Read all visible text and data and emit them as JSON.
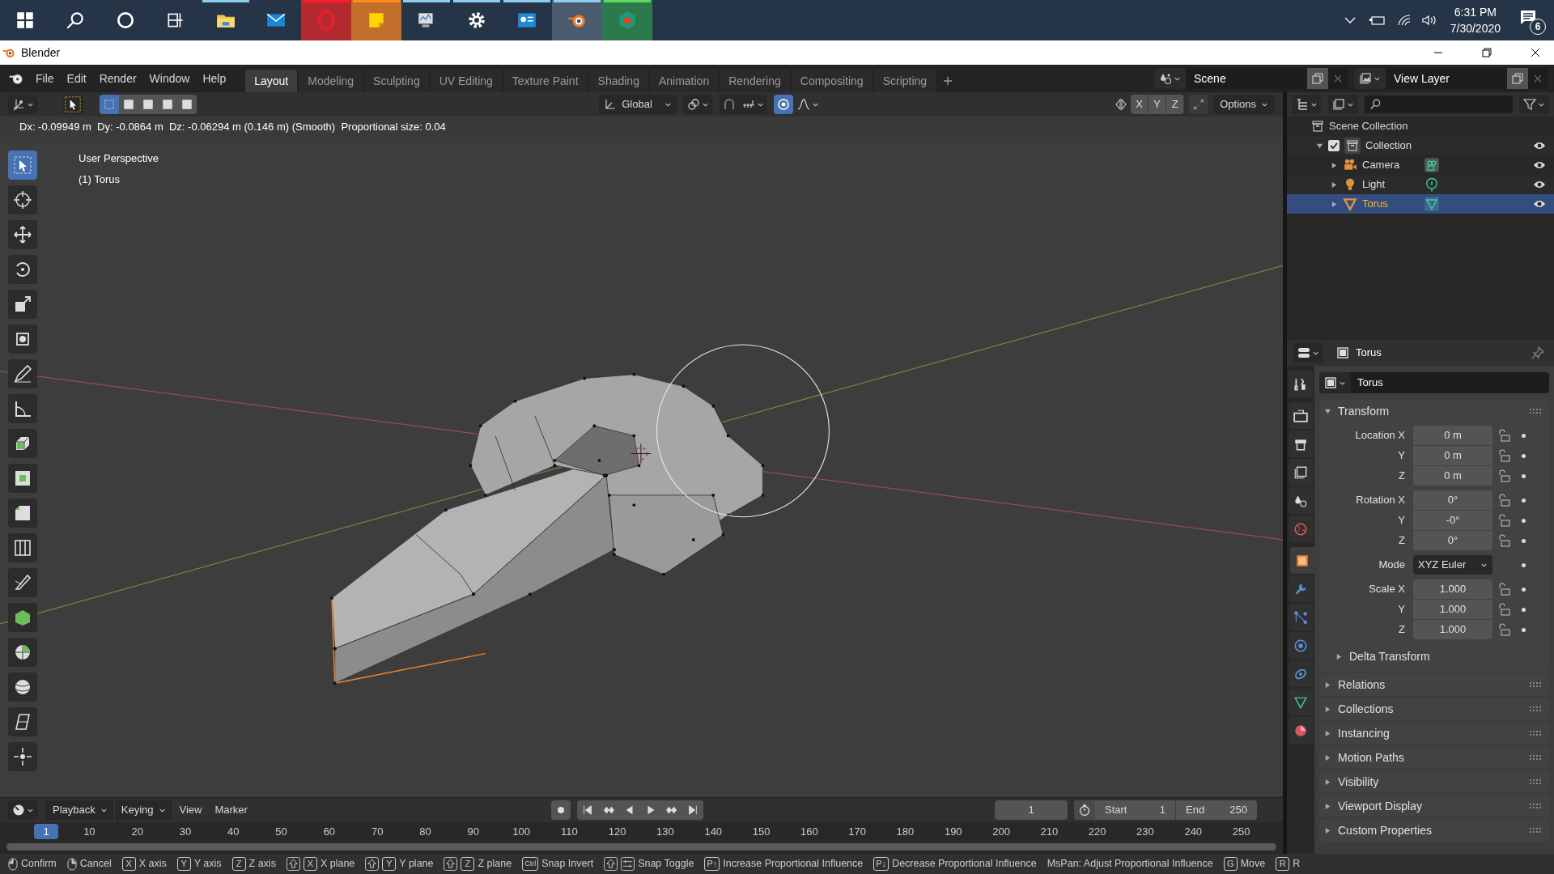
{
  "taskbar": {
    "apps": [
      {
        "kind": "start",
        "running": false,
        "selected": false
      },
      {
        "kind": "search",
        "running": false,
        "selected": false
      },
      {
        "kind": "cortana",
        "running": false,
        "selected": false
      },
      {
        "kind": "taskview",
        "running": false,
        "selected": false
      },
      {
        "kind": "explorer",
        "running": true,
        "selected": false
      },
      {
        "kind": "mail",
        "running": false,
        "selected": false
      },
      {
        "kind": "opera",
        "running": true,
        "selected": false
      },
      {
        "kind": "sticky",
        "running": true,
        "selected": false
      },
      {
        "kind": "monitor",
        "running": true,
        "selected": false
      },
      {
        "kind": "settings",
        "running": true,
        "selected": false
      },
      {
        "kind": "contact",
        "running": true,
        "selected": false
      },
      {
        "kind": "blender",
        "running": true,
        "selected": true
      },
      {
        "kind": "store",
        "running": true,
        "selected": false
      }
    ],
    "tray": {
      "time": "6:31 PM",
      "date": "7/30/2020",
      "notifications": "6"
    }
  },
  "window": {
    "title": "Blender"
  },
  "menu": [
    "File",
    "Edit",
    "Render",
    "Window",
    "Help"
  ],
  "workspaces": [
    {
      "label": "Layout",
      "selected": true
    },
    {
      "label": "Modeling",
      "selected": false
    },
    {
      "label": "Sculpting",
      "selected": false
    },
    {
      "label": "UV Editing",
      "selected": false
    },
    {
      "label": "Texture Paint",
      "selected": false
    },
    {
      "label": "Shading",
      "selected": false
    },
    {
      "label": "Animation",
      "selected": false
    },
    {
      "label": "Rendering",
      "selected": false
    },
    {
      "label": "Compositing",
      "selected": false
    },
    {
      "label": "Scripting",
      "selected": false
    }
  ],
  "scene": "Scene",
  "view_layer": "View Layer",
  "viewport": {
    "orientation": "Global",
    "axes": [
      "X",
      "Y",
      "Z"
    ],
    "options": "Options",
    "header_text": "Dx: -0.09949 m  Dy: -0.0864 m  Dz: -0.06294 m (0.146 m) (Smooth)  Proportional size: 0.04",
    "overlay": [
      "User Perspective",
      "(1) Torus"
    ],
    "tools": [
      {
        "kind": "select",
        "selected": true
      },
      {
        "kind": "cursor",
        "selected": false
      },
      {
        "kind": "move",
        "selected": false
      },
      {
        "kind": "rotate",
        "selected": false
      },
      {
        "kind": "scale",
        "selected": false
      },
      {
        "kind": "transform",
        "selected": false
      },
      {
        "kind": "annotate",
        "selected": false
      },
      {
        "kind": "measure",
        "selected": false
      },
      {
        "kind": "extrude",
        "selected": false
      },
      {
        "kind": "inset",
        "selected": false
      },
      {
        "kind": "bevel",
        "selected": false
      },
      {
        "kind": "loopcut",
        "selected": false
      },
      {
        "kind": "knife",
        "selected": false
      },
      {
        "kind": "polybuild",
        "selected": false
      },
      {
        "kind": "spin",
        "selected": false
      },
      {
        "kind": "smooth",
        "selected": false
      },
      {
        "kind": "shear",
        "selected": false
      },
      {
        "kind": "shrink",
        "selected": false
      }
    ]
  },
  "outliner": {
    "root": "Scene Collection",
    "children": [
      {
        "label": "Collection",
        "kind": "collection",
        "checked": true,
        "expanded": true,
        "selected": false,
        "children": [
          {
            "label": "Camera",
            "kind": "camera",
            "expanded": false,
            "selected": false
          },
          {
            "label": "Light",
            "kind": "light",
            "expanded": false,
            "selected": false
          },
          {
            "label": "Torus",
            "kind": "mesh",
            "expanded": false,
            "selected": true
          }
        ]
      }
    ]
  },
  "properties": {
    "tabs": [
      {
        "kind": "tool",
        "selected": false
      },
      {
        "kind": "render",
        "selected": false
      },
      {
        "kind": "output",
        "selected": false
      },
      {
        "kind": "view_layer",
        "selected": false
      },
      {
        "kind": "scene",
        "selected": false
      },
      {
        "kind": "world",
        "selected": false
      },
      {
        "kind": "object",
        "selected": true
      },
      {
        "kind": "modifiers",
        "selected": false
      },
      {
        "kind": "particles",
        "selected": false
      },
      {
        "kind": "physics",
        "selected": false
      },
      {
        "kind": "constraints",
        "selected": false
      },
      {
        "kind": "data",
        "selected": false
      },
      {
        "kind": "material",
        "selected": false
      }
    ],
    "title": "Torus",
    "name": "Torus",
    "transform": {
      "title": "Transform",
      "expanded": true,
      "groups": [
        {
          "rows": [
            {
              "label": "Location X",
              "value": "0 m",
              "kind": "number"
            },
            {
              "label": "Y",
              "value": "0 m",
              "kind": "number"
            },
            {
              "label": "Z",
              "value": "0 m",
              "kind": "number"
            }
          ]
        },
        {
          "rows": [
            {
              "label": "Rotation X",
              "value": "0°",
              "kind": "number"
            },
            {
              "label": "Y",
              "value": "-0°",
              "kind": "number"
            },
            {
              "label": "Z",
              "value": "0°",
              "kind": "number"
            }
          ]
        },
        {
          "rows": [
            {
              "label": "Mode",
              "value": "XYZ Euler",
              "kind": "dropdown"
            }
          ]
        },
        {
          "rows": [
            {
              "label": "Scale X",
              "value": "1.000",
              "kind": "number"
            },
            {
              "label": "Y",
              "value": "1.000",
              "kind": "number"
            },
            {
              "label": "Z",
              "value": "1.000",
              "kind": "number"
            }
          ]
        }
      ],
      "subpanel": "Delta Transform"
    },
    "panels": [
      "Relations",
      "Collections",
      "Instancing",
      "Motion Paths",
      "Visibility",
      "Viewport Display",
      "Custom Properties"
    ]
  },
  "timeline": {
    "menus": [
      {
        "label": "Playback",
        "dropdown": true
      },
      {
        "label": "Keying",
        "dropdown": true
      },
      {
        "label": "View",
        "dropdown": false
      },
      {
        "label": "Marker",
        "dropdown": false
      }
    ],
    "current_frame": "1",
    "start_label": "Start",
    "start": "1",
    "end_label": "End",
    "end": "250",
    "ticks": [
      {
        "label": "1",
        "selected": true
      },
      {
        "label": "10",
        "selected": false
      },
      {
        "label": "20",
        "selected": false
      },
      {
        "label": "30",
        "selected": false
      },
      {
        "label": "40",
        "selected": false
      },
      {
        "label": "50",
        "selected": false
      },
      {
        "label": "60",
        "selected": false
      },
      {
        "label": "70",
        "selected": false
      },
      {
        "label": "80",
        "selected": false
      },
      {
        "label": "90",
        "selected": false
      },
      {
        "label": "100",
        "selected": false
      },
      {
        "label": "110",
        "selected": false
      },
      {
        "label": "120",
        "selected": false
      },
      {
        "label": "130",
        "selected": false
      },
      {
        "label": "140",
        "selected": false
      },
      {
        "label": "150",
        "selected": false
      },
      {
        "label": "160",
        "selected": false
      },
      {
        "label": "170",
        "selected": false
      },
      {
        "label": "180",
        "selected": false
      },
      {
        "label": "190",
        "selected": false
      },
      {
        "label": "200",
        "selected": false
      },
      {
        "label": "210",
        "selected": false
      },
      {
        "label": "220",
        "selected": false
      },
      {
        "label": "230",
        "selected": false
      },
      {
        "label": "240",
        "selected": false
      },
      {
        "label": "250",
        "selected": false
      }
    ]
  },
  "status_bar": [
    {
      "keys": [
        {
          "kind": "mouse-left"
        }
      ],
      "label": "Confirm"
    },
    {
      "keys": [
        {
          "kind": "mouse-right"
        }
      ],
      "label": "Cancel"
    },
    {
      "keys": [
        {
          "kind": "key",
          "text": "X"
        }
      ],
      "label": "X axis"
    },
    {
      "keys": [
        {
          "kind": "key",
          "text": "Y"
        }
      ],
      "label": "Y axis"
    },
    {
      "keys": [
        {
          "kind": "key",
          "text": "Z"
        }
      ],
      "label": "Z axis"
    },
    {
      "keys": [
        {
          "kind": "shift"
        },
        {
          "kind": "key",
          "text": "X"
        }
      ],
      "label": "X plane"
    },
    {
      "keys": [
        {
          "kind": "shift"
        },
        {
          "kind": "key",
          "text": "Y"
        }
      ],
      "label": "Y plane"
    },
    {
      "keys": [
        {
          "kind": "shift"
        },
        {
          "kind": "key",
          "text": "Z"
        }
      ],
      "label": "Z plane"
    },
    {
      "keys": [
        {
          "kind": "key",
          "text": "Ctrl"
        }
      ],
      "label": "Snap Invert"
    },
    {
      "keys": [
        {
          "kind": "shift"
        },
        {
          "kind": "snap"
        }
      ],
      "label": "Snap Toggle"
    },
    {
      "keys": [
        {
          "kind": "key",
          "text": "P↑"
        }
      ],
      "label": "Increase Proportional Influence"
    },
    {
      "keys": [
        {
          "kind": "key",
          "text": "P↓"
        }
      ],
      "label": "Decrease Proportional Influence"
    },
    {
      "label": "MsPan: Adjust Proportional Influence"
    },
    {
      "keys": [
        {
          "kind": "key",
          "text": "G"
        }
      ],
      "label": "Move"
    },
    {
      "keys": [
        {
          "kind": "key",
          "text": "R"
        }
      ],
      "label": "R"
    }
  ]
}
